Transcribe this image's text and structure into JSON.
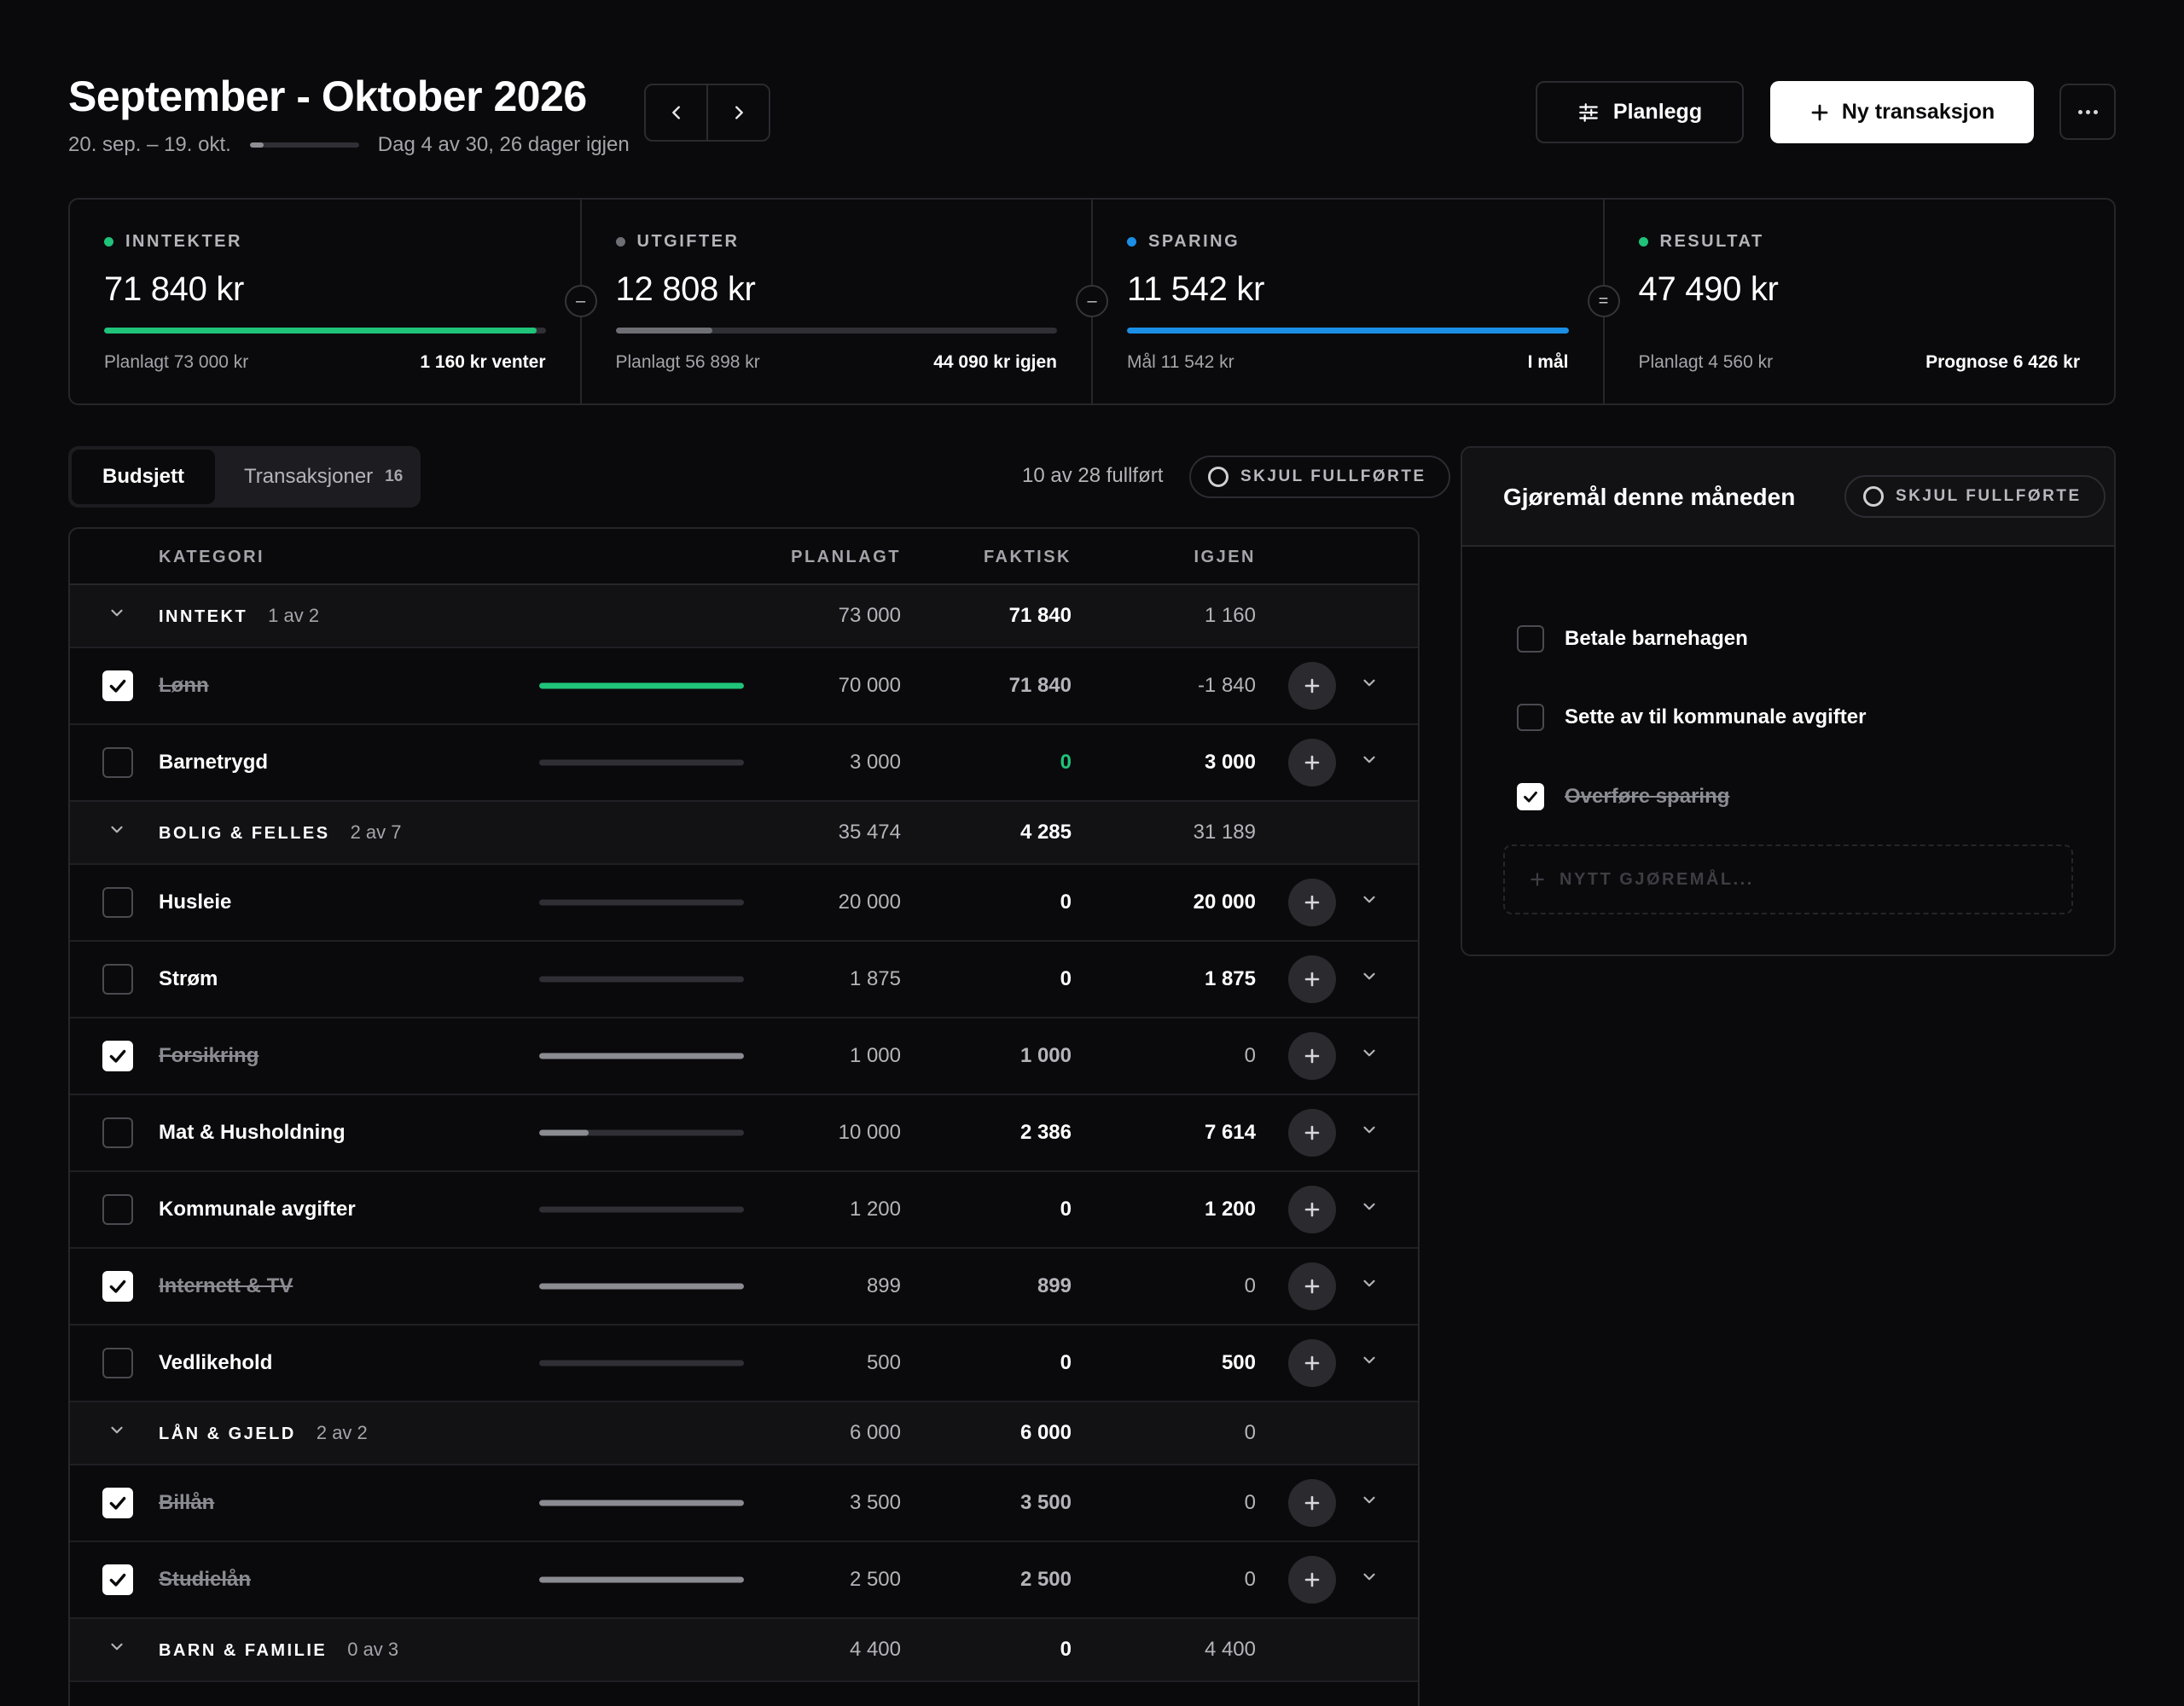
{
  "header": {
    "title": "September - Oktober 2026",
    "date_range": "20. sep. – 19. okt.",
    "period_progress": 0.13,
    "day_info": "Dag 4 av 30, 26 dager igjen",
    "plan_label": "Planlegg",
    "new_label": "Ny transaksjon"
  },
  "summary": {
    "income": {
      "label": "INNTEKTER",
      "value": "71 840 kr",
      "left": "Planlagt 73 000 kr",
      "right": "1 160 kr venter",
      "progress": 0.98,
      "color": "#1fc37a"
    },
    "expenses": {
      "label": "UTGIFTER",
      "value": "12 808 kr",
      "left": "Planlagt 56 898 kr",
      "right": "44 090 kr igjen",
      "progress": 0.22,
      "color": "#6e6e75"
    },
    "savings": {
      "label": "SPARING",
      "value": "11 542 kr",
      "left": "Mål 11 542 kr",
      "right": "I mål",
      "progress": 1.0,
      "color": "#1b8fe6"
    },
    "result": {
      "label": "RESULTAT",
      "value": "47 490 kr",
      "left": "Planlagt 4 560 kr",
      "right": "Prognose 6 426 kr",
      "color": "#1fc37a"
    },
    "ops": [
      "–",
      "–",
      "="
    ]
  },
  "tabs": {
    "budget": "Budsjett",
    "transactions": "Transaksjoner",
    "transactions_count": "16"
  },
  "progress_text": "10 av 28 fullført",
  "hide_done_label": "SKJUL FULLFØRTE",
  "table": {
    "headers": {
      "category": "KATEGORI",
      "planned": "PLANLAGT",
      "actual": "FAKTISK",
      "remaining": "IGJEN"
    },
    "groups": [
      {
        "name": "INNTEKT",
        "count": "1 av 2",
        "planned": "73 000",
        "actual": "71 840",
        "remaining": "1 160"
      },
      {
        "name": "BOLIG & FELLES",
        "count": "2 av 7",
        "planned": "35 474",
        "actual": "4 285",
        "remaining": "31 189"
      },
      {
        "name": "LÅN & GJELD",
        "count": "2 av 2",
        "planned": "6 000",
        "actual": "6 000",
        "remaining": "0"
      },
      {
        "name": "BARN & FAMILIE",
        "count": "0 av 3",
        "planned": "4 400",
        "actual": "0",
        "remaining": "4 400"
      }
    ],
    "rows": [
      {
        "name": "Lønn",
        "done": true,
        "planned": "70 000",
        "actual": "71 840",
        "remaining": "-1 840",
        "progress": 1.0
      },
      {
        "name": "Barnetrygd",
        "done": false,
        "planned": "3 000",
        "actual": "0",
        "remaining": "3 000",
        "progress": 0
      },
      {
        "name": "Husleie",
        "done": false,
        "planned": "20 000",
        "actual": "0",
        "remaining": "20 000",
        "progress": 0
      },
      {
        "name": "Strøm",
        "done": false,
        "planned": "1 875",
        "actual": "0",
        "remaining": "1 875",
        "progress": 0
      },
      {
        "name": "Forsikring",
        "done": true,
        "planned": "1 000",
        "actual": "1 000",
        "remaining": "0",
        "progress": 1.0
      },
      {
        "name": "Mat & Husholdning",
        "done": false,
        "planned": "10 000",
        "actual": "2 386",
        "remaining": "7 614",
        "progress": 0.24
      },
      {
        "name": "Kommunale avgifter",
        "done": false,
        "planned": "1 200",
        "actual": "0",
        "remaining": "1 200",
        "progress": 0
      },
      {
        "name": "Internett & TV",
        "done": true,
        "planned": "899",
        "actual": "899",
        "remaining": "0",
        "progress": 1.0
      },
      {
        "name": "Vedlikehold",
        "done": false,
        "planned": "500",
        "actual": "0",
        "remaining": "500",
        "progress": 0
      },
      {
        "name": "Billån",
        "done": true,
        "planned": "3 500",
        "actual": "3 500",
        "remaining": "0",
        "progress": 1.0
      },
      {
        "name": "Studielån",
        "done": true,
        "planned": "2 500",
        "actual": "2 500",
        "remaining": "0",
        "progress": 1.0
      }
    ]
  },
  "todo": {
    "title": "Gjøremål denne måneden",
    "items": [
      {
        "label": "Betale barnehagen",
        "done": false
      },
      {
        "label": "Sette av til kommunale avgifter",
        "done": false
      },
      {
        "label": "Overføre sparing",
        "done": true
      }
    ],
    "new_placeholder": "NYTT GJØREMÅL..."
  },
  "colors": {
    "green": "#1fc37a",
    "blue": "#1b8fe6",
    "bar_done": "#8b8b92"
  }
}
